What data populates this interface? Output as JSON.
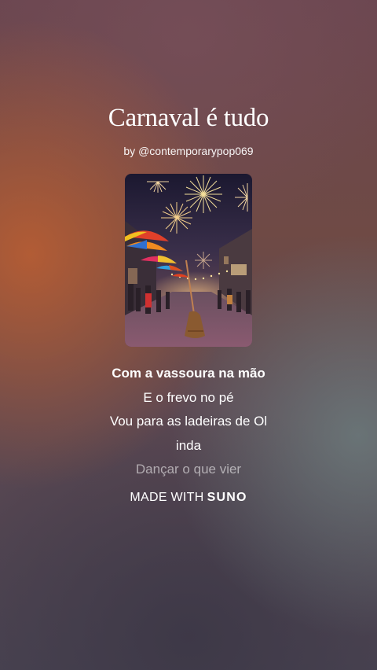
{
  "song": {
    "title": "Carnaval é tudo",
    "byline": "by @contemporarypop069"
  },
  "lyrics": [
    {
      "text": "Com a vassoura na mão",
      "state": "current"
    },
    {
      "text": "E o frevo no pé",
      "state": "normal"
    },
    {
      "text": "Vou para as ladeiras de Ol",
      "state": "normal"
    },
    {
      "text": "inda",
      "state": "normal"
    },
    {
      "text": "Dançar o que vier",
      "state": "faded"
    }
  ],
  "footer": {
    "made_with": "MADE WITH",
    "brand": "SUNO"
  }
}
